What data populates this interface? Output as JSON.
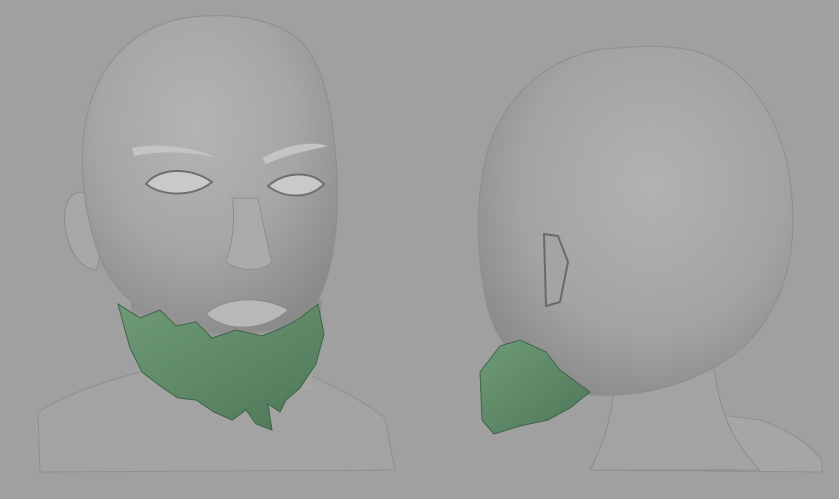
{
  "viewport": {
    "background": "#a0a0a0",
    "skin_color": "#9a9a9a",
    "beard_color": "#5c8a66"
  },
  "views": [
    {
      "name": "front-three-quarter-view"
    },
    {
      "name": "back-three-quarter-view"
    }
  ]
}
